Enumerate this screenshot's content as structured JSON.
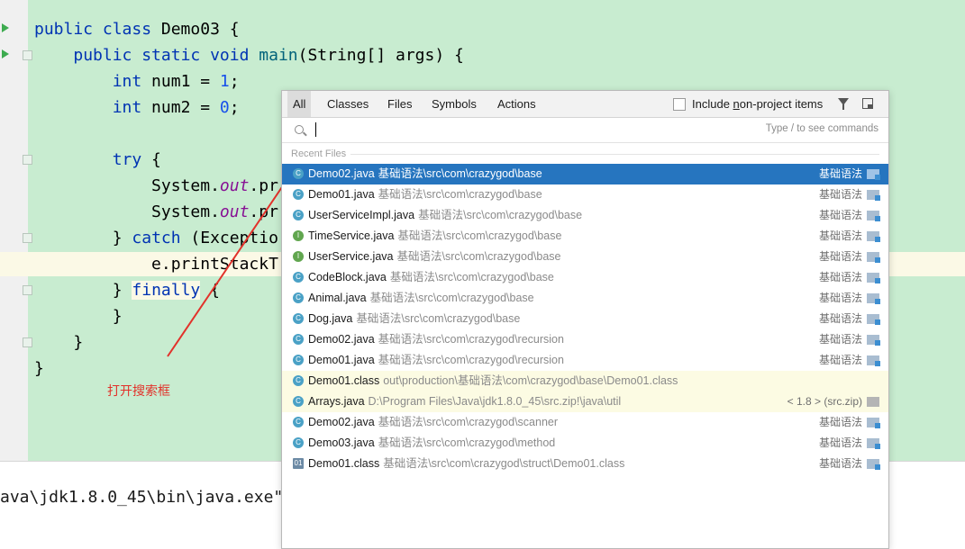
{
  "editor": {
    "lines": [
      [
        "public class Demo03 {"
      ],
      [
        "    public static void main(String[] args) {"
      ],
      [
        "        int num1 = 1;"
      ],
      [
        "        int num2 = 0;"
      ],
      [
        ""
      ],
      [
        "        try {"
      ],
      [
        "            System.out.pr"
      ],
      [
        "            System.out.pr"
      ],
      [
        "        } catch (Exceptio"
      ],
      [
        "            e.printStackT"
      ],
      [
        "        } finally {"
      ],
      [
        "        }"
      ],
      [
        "    }"
      ],
      [
        "}"
      ]
    ],
    "tokens": {
      "l1_kw": "public class",
      "l1_rest": " Demo03 {",
      "l2_kw": "public static void",
      "l2_fn": " main",
      "l2_rest": "(String[] args) {",
      "l3_kw": "int",
      "l3_mid": " num1 = ",
      "l3_num": "1",
      "l3_end": ";",
      "l4_kw": "int",
      "l4_mid": " num2 = ",
      "l4_num": "0",
      "l4_end": ";",
      "l6_kw": "try",
      "l6_rest": " {",
      "l7_pre": "System.",
      "l7_it": "out",
      "l7_rest": ".pr",
      "l8_pre": "System.",
      "l8_it": "out",
      "l8_rest": ".pr",
      "l9_pre": "} ",
      "l9_kw": "catch",
      "l9_rest": " (Exceptio",
      "l10": "e.printStackT",
      "l11_pre": "} ",
      "l11_kw": "finally",
      "l11_rest": " {",
      "l12": "}",
      "l13": "}",
      "l14": "}"
    }
  },
  "console": {
    "line": "ava\\jdk1.8.0_45\\bin\\java.exe\""
  },
  "annotation": {
    "text": "打开搜索框",
    "color": "#e2312a"
  },
  "popup": {
    "tabs": [
      "All",
      "Classes",
      "Files",
      "Symbols",
      "Actions"
    ],
    "active_tab": "All",
    "include_label_pre": "Include ",
    "include_label_u": "n",
    "include_label_post": "on-project items",
    "search_placeholder": "",
    "hint": "Type / to see commands",
    "section": "Recent Files",
    "selected_color": "#2675bf",
    "items": [
      {
        "name": "Demo02.java",
        "path": "基础语法\\src\\com\\crazygod\\base",
        "module": "基础语法",
        "icon": "class-run-icon"
      },
      {
        "name": "Demo01.java",
        "path": "基础语法\\src\\com\\crazygod\\base",
        "module": "基础语法",
        "icon": "class-run-icon"
      },
      {
        "name": "UserServiceImpl.java",
        "path": "基础语法\\src\\com\\crazygod\\base",
        "module": "基础语法",
        "icon": "class-icon"
      },
      {
        "name": "TimeService.java",
        "path": "基础语法\\src\\com\\crazygod\\base",
        "module": "基础语法",
        "icon": "interface-icon"
      },
      {
        "name": "UserService.java",
        "path": "基础语法\\src\\com\\crazygod\\base",
        "module": "基础语法",
        "icon": "interface-icon"
      },
      {
        "name": "CodeBlock.java",
        "path": "基础语法\\src\\com\\crazygod\\base",
        "module": "基础语法",
        "icon": "class-icon"
      },
      {
        "name": "Animal.java",
        "path": "基础语法\\src\\com\\crazygod\\base",
        "module": "基础语法",
        "icon": "class-icon"
      },
      {
        "name": "Dog.java",
        "path": "基础语法\\src\\com\\crazygod\\base",
        "module": "基础语法",
        "icon": "class-run-icon"
      },
      {
        "name": "Demo02.java",
        "path": "基础语法\\src\\com\\crazygod\\recursion",
        "module": "基础语法",
        "icon": "class-run-icon"
      },
      {
        "name": "Demo01.java",
        "path": "基础语法\\src\\com\\crazygod\\recursion",
        "module": "基础语法",
        "icon": "class-run-icon"
      },
      {
        "name": "Demo01.class",
        "path": "out\\production\\基础语法\\com\\crazygod\\base\\Demo01.class",
        "module": "",
        "icon": "class-icon"
      },
      {
        "name": "Arrays.java",
        "path": "D:\\Program Files\\Java\\jdk1.8.0_45\\src.zip!\\java\\util",
        "module": "< 1.8 > (src.zip)",
        "icon": "class-run-icon"
      },
      {
        "name": "Demo02.java",
        "path": "基础语法\\src\\com\\crazygod\\scanner",
        "module": "基础语法",
        "icon": "class-run-icon"
      },
      {
        "name": "Demo03.java",
        "path": "基础语法\\src\\com\\crazygod\\method",
        "module": "基础语法",
        "icon": "class-run-icon"
      },
      {
        "name": "Demo01.class",
        "path": "基础语法\\src\\com\\crazygod\\struct\\Demo01.class",
        "module": "基础语法",
        "icon": "binary-class-icon"
      }
    ]
  }
}
